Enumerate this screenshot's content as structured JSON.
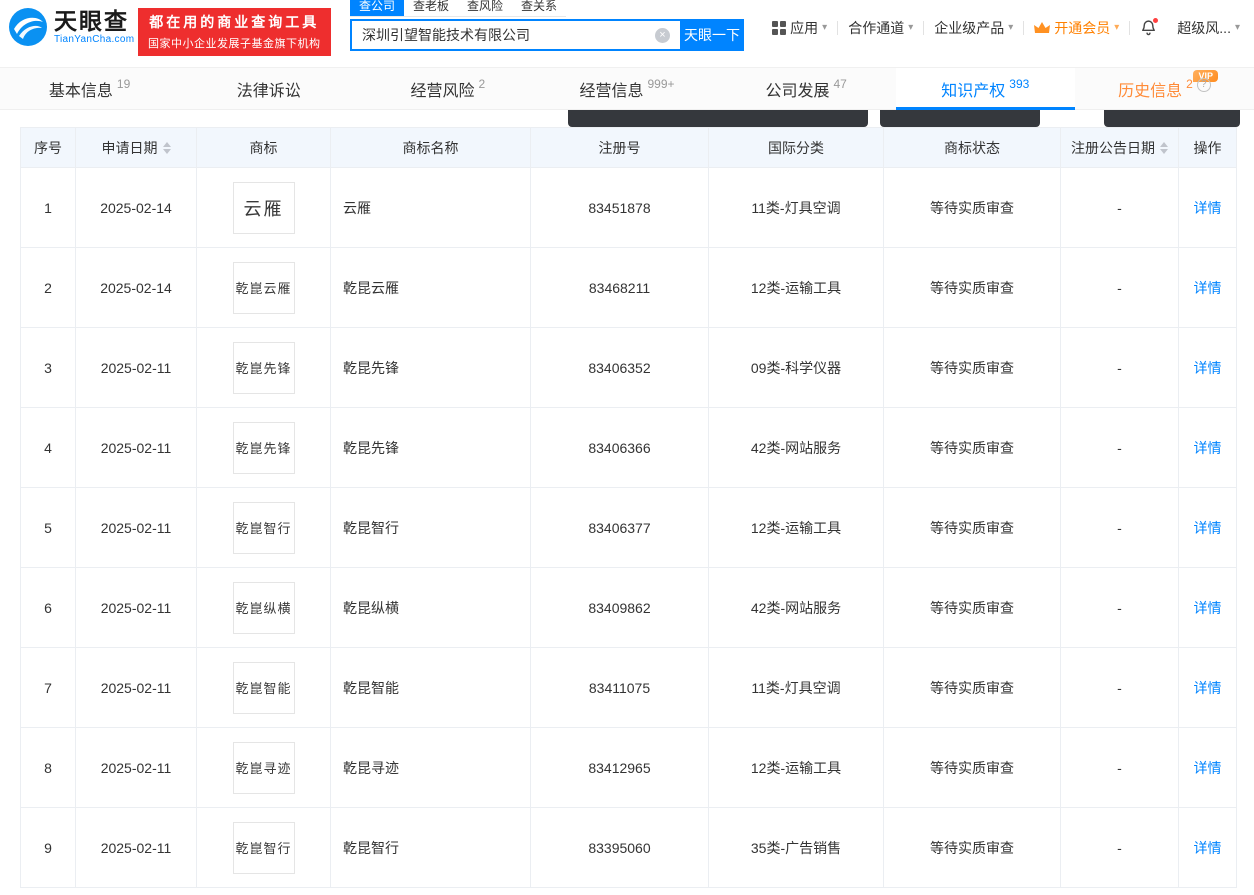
{
  "header": {
    "logo": {
      "title": "天眼查",
      "subtitle": "TianYanCha.com"
    },
    "slogan": {
      "line1": "都在用的商业查询工具",
      "line2": "国家中小企业发展子基金旗下机构"
    },
    "search_tabs": [
      {
        "label": "查公司",
        "active": true
      },
      {
        "label": "查老板"
      },
      {
        "label": "查风险"
      },
      {
        "label": "查关系"
      }
    ],
    "search": {
      "value": "深圳引望智能技术有限公司",
      "button_label": "天眼一下"
    },
    "nav_items": [
      {
        "label": "应用",
        "icon": "grid-icon",
        "caret": true
      },
      {
        "label": "合作通道",
        "caret": true
      },
      {
        "label": "企业级产品",
        "caret": true
      },
      {
        "label": "开通会员",
        "icon": "crown-icon",
        "caret": true,
        "accent": true
      },
      {
        "icon": "bell-icon",
        "badge": true
      },
      {
        "label": "超级风...",
        "caret": true
      }
    ]
  },
  "tabs": [
    {
      "label": "基本信息",
      "count": "19"
    },
    {
      "label": "法律诉讼",
      "count": ""
    },
    {
      "label": "经营风险",
      "count": "2"
    },
    {
      "label": "经营信息",
      "count": "999+"
    },
    {
      "label": "公司发展",
      "count": "47"
    },
    {
      "label": "知识产权",
      "count": "393",
      "active": true
    },
    {
      "label": "历史信息",
      "count": "2",
      "vip": true,
      "vip_label": "VIP",
      "help": true
    }
  ],
  "table": {
    "columns": [
      "序号",
      "申请日期",
      "商标",
      "商标名称",
      "注册号",
      "国际分类",
      "商标状态",
      "注册公告日期",
      "操作"
    ],
    "sortable_columns": [
      1,
      7
    ],
    "action_label": "详情",
    "rows": [
      {
        "no": "1",
        "date": "2025-02-14",
        "mark_image_text": "云雁",
        "name": "云雁",
        "reg_no": "83451878",
        "intl_class": "11类-灯具空调",
        "status": "等待实质审查",
        "pub_date": "-"
      },
      {
        "no": "2",
        "date": "2025-02-14",
        "mark_image_text": "乾崑云雁",
        "name": "乾昆云雁",
        "reg_no": "83468211",
        "intl_class": "12类-运输工具",
        "status": "等待实质审查",
        "pub_date": "-"
      },
      {
        "no": "3",
        "date": "2025-02-11",
        "mark_image_text": "乾崑先锋",
        "name": "乾昆先锋",
        "reg_no": "83406352",
        "intl_class": "09类-科学仪器",
        "status": "等待实质审查",
        "pub_date": "-"
      },
      {
        "no": "4",
        "date": "2025-02-11",
        "mark_image_text": "乾崑先锋",
        "name": "乾昆先锋",
        "reg_no": "83406366",
        "intl_class": "42类-网站服务",
        "status": "等待实质审查",
        "pub_date": "-"
      },
      {
        "no": "5",
        "date": "2025-02-11",
        "mark_image_text": "乾崑智行",
        "name": "乾昆智行",
        "reg_no": "83406377",
        "intl_class": "12类-运输工具",
        "status": "等待实质审查",
        "pub_date": "-"
      },
      {
        "no": "6",
        "date": "2025-02-11",
        "mark_image_text": "乾崑纵横",
        "name": "乾昆纵横",
        "reg_no": "83409862",
        "intl_class": "42类-网站服务",
        "status": "等待实质审查",
        "pub_date": "-"
      },
      {
        "no": "7",
        "date": "2025-02-11",
        "mark_image_text": "乾崑智能",
        "name": "乾昆智能",
        "reg_no": "83411075",
        "intl_class": "11类-灯具空调",
        "status": "等待实质审查",
        "pub_date": "-"
      },
      {
        "no": "8",
        "date": "2025-02-11",
        "mark_image_text": "乾崑寻迹",
        "name": "乾昆寻迹",
        "reg_no": "83412965",
        "intl_class": "12类-运输工具",
        "status": "等待实质审查",
        "pub_date": "-"
      },
      {
        "no": "9",
        "date": "2025-02-11",
        "mark_image_text": "乾崑智行",
        "name": "乾昆智行",
        "reg_no": "83395060",
        "intl_class": "35类-广告销售",
        "status": "等待实质审查",
        "pub_date": "-"
      }
    ]
  }
}
